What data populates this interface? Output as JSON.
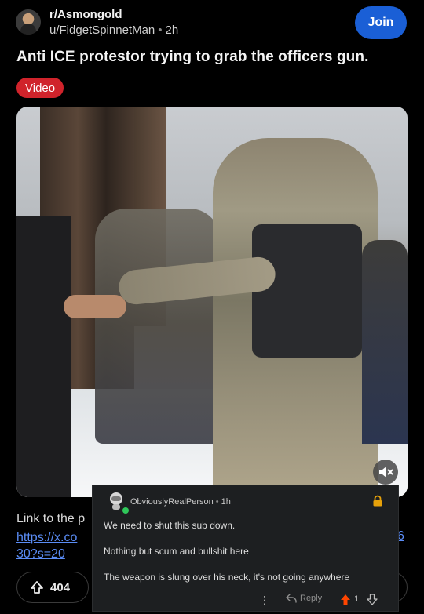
{
  "header": {
    "subreddit": "r/Asmongold",
    "username": "u/FidgetSpinnetMan",
    "separator": "•",
    "age": "2h",
    "join_label": "Join"
  },
  "post": {
    "title": "Anti ICE protestor trying to grab the officers gun.",
    "flair": "Video",
    "link_lead": "Link to the p",
    "link_line1": "https://x.co",
    "link_line2": "30?s=20",
    "link_tail": "6",
    "upvotes": "404"
  },
  "comment": {
    "author": "ObviouslyRealPerson",
    "separator": "•",
    "age": "1h",
    "lines": [
      "We need to shut this sub down.",
      "Nothing but scum and bullshit here",
      "The weapon is slung over his neck, it's not going anywhere"
    ],
    "more": "⋮",
    "reply_label": "Reply",
    "score": "1"
  },
  "colors": {
    "join": "#1a5fd6",
    "flair": "#d0232b",
    "link": "#5a8cf5",
    "upvote": "#ff4500",
    "online": "#2fc75a"
  },
  "icons": {
    "mute": "speaker-muted-icon",
    "upvote": "arrow-up-icon",
    "downvote": "arrow-down-icon",
    "lock": "lock-icon",
    "reply": "reply-icon",
    "more": "more-vertical-icon"
  }
}
